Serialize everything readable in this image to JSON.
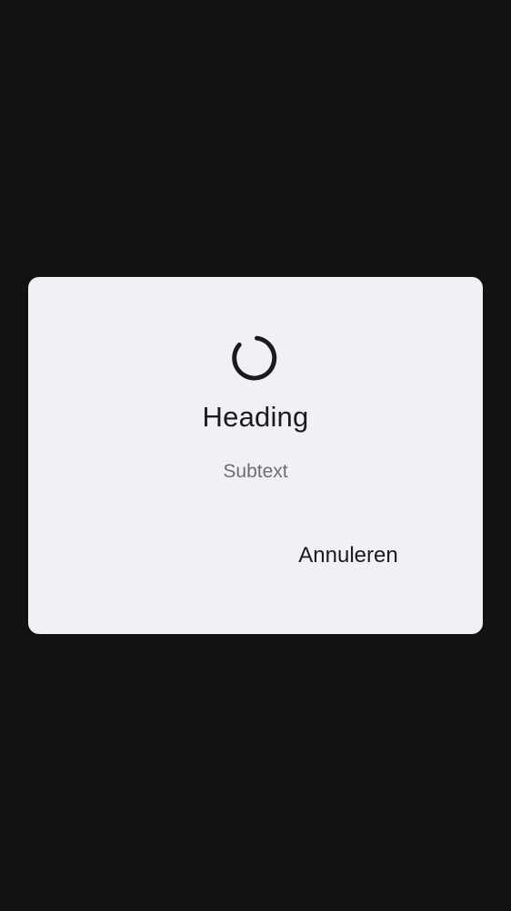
{
  "dialog": {
    "heading": "Heading",
    "subtext": "Subtext",
    "cancel_label": "Annuleren",
    "spinner_icon": "loading-spinner-icon"
  },
  "colors": {
    "backdrop": "#121212",
    "dialog_background": "#f0f1f5",
    "heading_text": "#1b1b1f",
    "subtext": "#6d6e74",
    "spinner": "#1b1b1f"
  }
}
